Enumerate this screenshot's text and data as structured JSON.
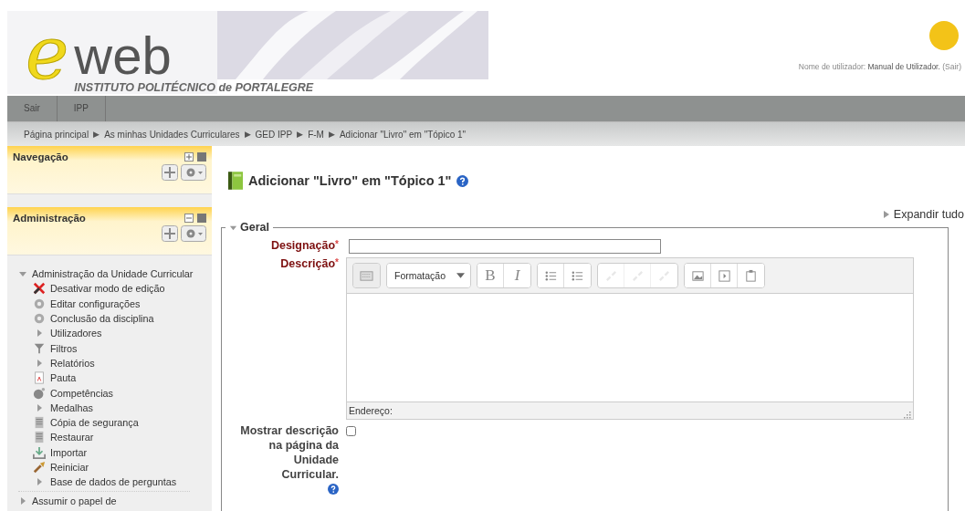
{
  "header": {
    "logo_letter": "e",
    "logo_word": "web",
    "institution": "INSTITUTO POLITÉCNICO de PORTALEGRE",
    "user_label": "Nome de utilizador:",
    "user_name": "Manual de Utilizador.",
    "logout": "(Sair)"
  },
  "nav_bar": [
    "Sair",
    "IPP"
  ],
  "breadcrumb": [
    {
      "label": "Página principal"
    },
    {
      "separator": "▶",
      "label": "As minhas Unidades Curriculares"
    },
    {
      "separator": "▶",
      "label": "GED IPP"
    },
    {
      "separator": "▶",
      "label": "F-M"
    },
    {
      "separator": "▶",
      "label": "Adicionar \"Livro\" em \"Tópico 1\""
    }
  ],
  "blocks": [
    {
      "title": "Navegação",
      "collapsed": true
    },
    {
      "title": "Administração",
      "collapsed": false
    }
  ],
  "admin_tree": [
    {
      "label": "Administração da Unidade Curricular",
      "kind": "branch",
      "expanded": true,
      "children": [
        {
          "label": "Desativar modo de edição",
          "kind": "leaf"
        },
        {
          "label": "Editar configurações",
          "kind": "leaf"
        },
        {
          "label": "Conclusão da disciplina",
          "kind": "leaf"
        },
        {
          "label": "Utilizadores",
          "kind": "branch",
          "expanded": false
        },
        {
          "label": "Filtros",
          "kind": "leaf"
        },
        {
          "label": "Relatórios",
          "kind": "branch",
          "expanded": false
        },
        {
          "label": "Pauta",
          "kind": "leaf"
        },
        {
          "label": "Competências",
          "kind": "leaf"
        },
        {
          "label": "Medalhas",
          "kind": "branch",
          "expanded": false
        },
        {
          "label": "Cópia de segurança",
          "kind": "leaf"
        },
        {
          "label": "Restaurar",
          "kind": "leaf"
        },
        {
          "label": "Importar",
          "kind": "leaf"
        },
        {
          "label": "Reiniciar",
          "kind": "leaf"
        },
        {
          "label": "Base de dados de perguntas",
          "kind": "branch",
          "expanded": false
        }
      ]
    },
    {
      "label": "Assumir o papel de",
      "kind": "branch",
      "expanded": false
    }
  ],
  "page_title": "Adicionar \"Livro\" em \"Tópico 1\"",
  "expand_all": "Expandir tudo",
  "section": {
    "legend": "Geral",
    "expanded": true
  },
  "fields": {
    "name_label": "Designação",
    "required_mark": "*",
    "description_label": "Descrição",
    "format_label": "Formatação",
    "path_label": "Endereço:",
    "show_label": "Mostrar descrição na página da Unidade Curricular.",
    "show_checked": false
  },
  "toolbar": [
    [
      {
        "disabled": false
      }
    ],
    [
      {
        "label": "B",
        "disabled": false
      },
      {
        "label": "I",
        "disabled": false
      }
    ],
    [
      {
        "disabled": false
      },
      {
        "disabled": false
      }
    ],
    [
      {
        "disabled": true
      },
      {
        "disabled": true
      },
      {
        "disabled": true
      }
    ],
    [
      {
        "disabled": false
      },
      {
        "disabled": false
      },
      {
        "disabled": false
      }
    ]
  ]
}
